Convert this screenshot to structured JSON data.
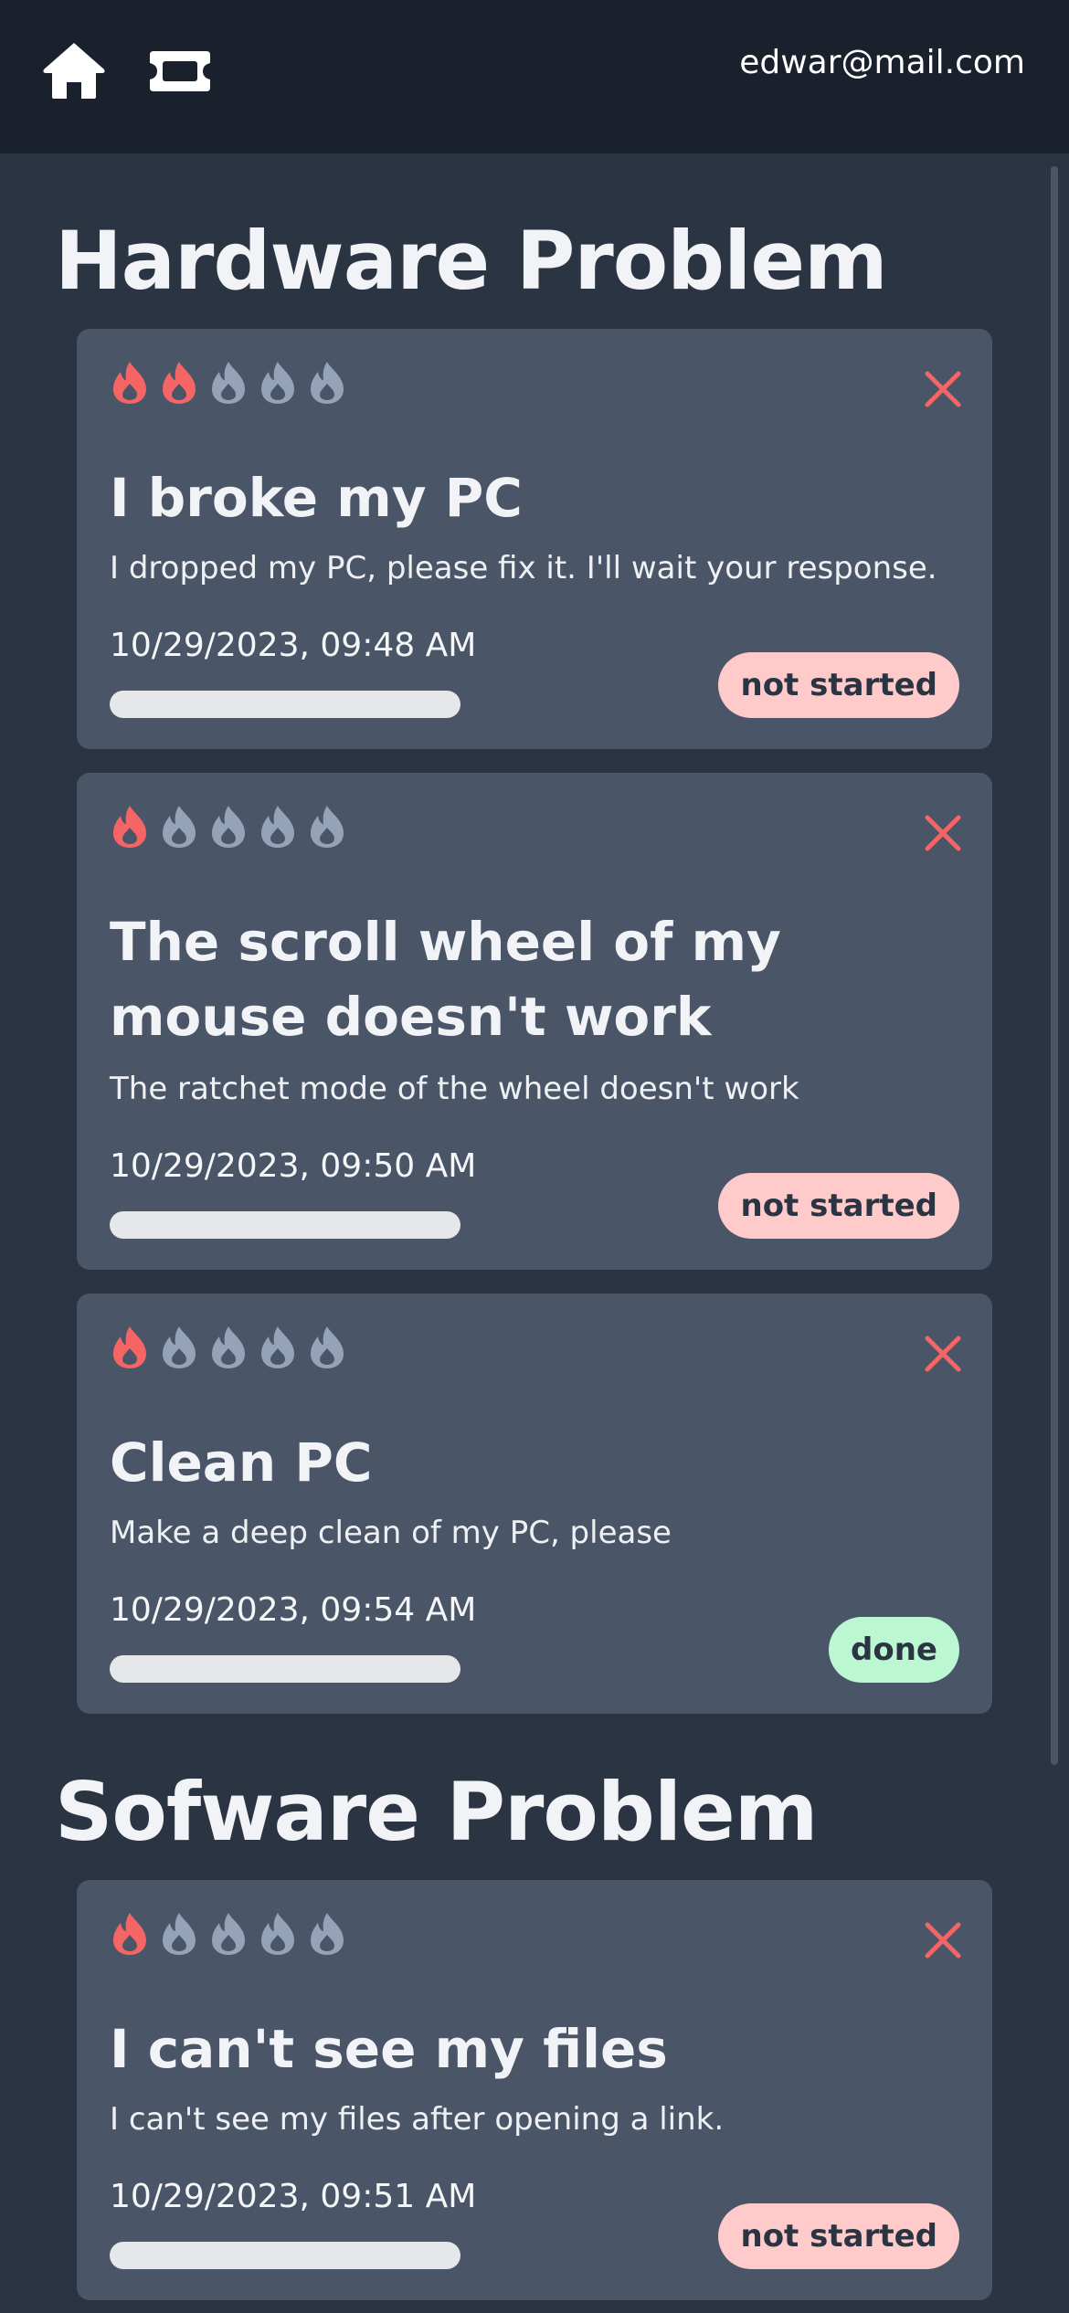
{
  "header": {
    "nav": [
      {
        "icon": "home-icon"
      },
      {
        "icon": "ticket-icon"
      }
    ],
    "user_email": "edwar@mail.com"
  },
  "colors": {
    "flame_active": "#f56565",
    "flame_inactive": "#94a3b8",
    "close": "#f56565",
    "status_not_started": "#fecaca",
    "status_done": "#bbf7d0"
  },
  "sections": [
    {
      "title": "Hardware Problem",
      "tickets": [
        {
          "priority": 2,
          "priority_max": 5,
          "title": "I broke my PC",
          "description": "I dropped my PC, please fix it. I'll wait your response.",
          "date": "10/29/2023, 09:48 AM",
          "progress": 0,
          "status": "not started",
          "status_kind": "not_started"
        },
        {
          "priority": 1,
          "priority_max": 5,
          "title": "The scroll wheel of my mouse doesn't work",
          "description": "The ratchet mode of the wheel doesn't work",
          "date": "10/29/2023, 09:50 AM",
          "progress": 0,
          "status": "not started",
          "status_kind": "not_started"
        },
        {
          "priority": 1,
          "priority_max": 5,
          "title": "Clean PC",
          "description": "Make a deep clean of my PC, please",
          "date": "10/29/2023, 09:54 AM",
          "progress": 0,
          "status": "done",
          "status_kind": "done"
        }
      ]
    },
    {
      "title": "Sofware Problem",
      "tickets": [
        {
          "priority": 1,
          "priority_max": 5,
          "title": "I can't see my files",
          "description": "I can't see my files after opening a link.",
          "date": "10/29/2023, 09:51 AM",
          "progress": 0,
          "status": "not started",
          "status_kind": "not_started"
        }
      ]
    }
  ]
}
